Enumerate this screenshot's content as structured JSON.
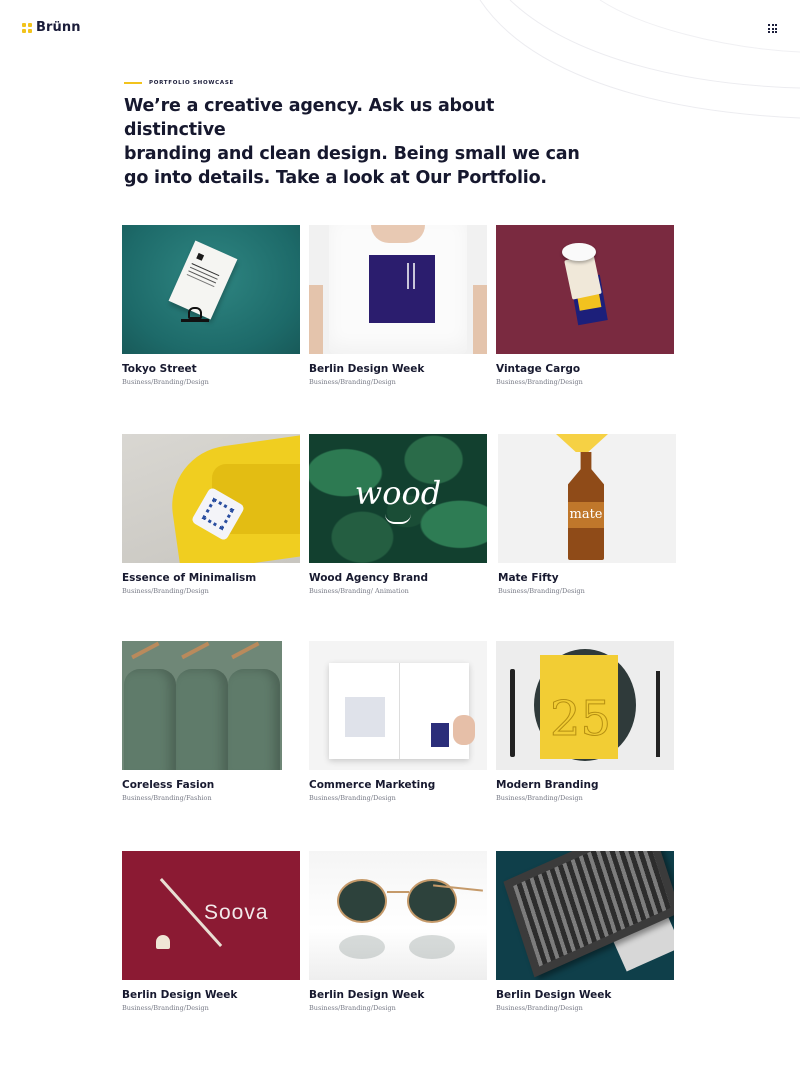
{
  "header": {
    "logo_text": "Brünn",
    "brand_accent": "#f2c31c",
    "menu_icon": "grid-menu-icon"
  },
  "intro": {
    "eyebrow": "PORTFOLIO SHOWCASE",
    "headline_lines": [
      "We’re a creative agency. Ask us about distinctive",
      "branding and clean design. Being small we can",
      "go into details. Take a look at Our Portfolio."
    ]
  },
  "portfolio": [
    {
      "title": "Tokyo Street",
      "category": "Business/Branding/Design"
    },
    {
      "title": "Berlin Design Week",
      "category": "Business/Branding/Design"
    },
    {
      "title": "Vintage Cargo",
      "category": "Business/Branding/Design"
    },
    {
      "title": "Essence of Minimalism",
      "category": "Business/Branding/Design"
    },
    {
      "title": "Wood Agency Brand",
      "category": "Business/Branding/ Animation"
    },
    {
      "title": "Mate Fifty",
      "category": "Business/Branding/Design"
    },
    {
      "title": "Coreless Fasion",
      "category": "Business/Branding/Fashion"
    },
    {
      "title": "Commerce Marketing",
      "category": "Business/Branding/Design"
    },
    {
      "title": "Modern Branding",
      "category": "Business/Branding/Design"
    },
    {
      "title": "Berlin Design Week",
      "category": "Business/Branding/Design"
    },
    {
      "title": "Berlin Design Week",
      "category": "Business/Branding/Design"
    },
    {
      "title": "Berlin Design Week",
      "category": "Business/Branding/Design"
    }
  ],
  "image_text": {
    "wood": "wood",
    "mate": "mate",
    "soova": "Soova",
    "book_numeral": "25"
  }
}
